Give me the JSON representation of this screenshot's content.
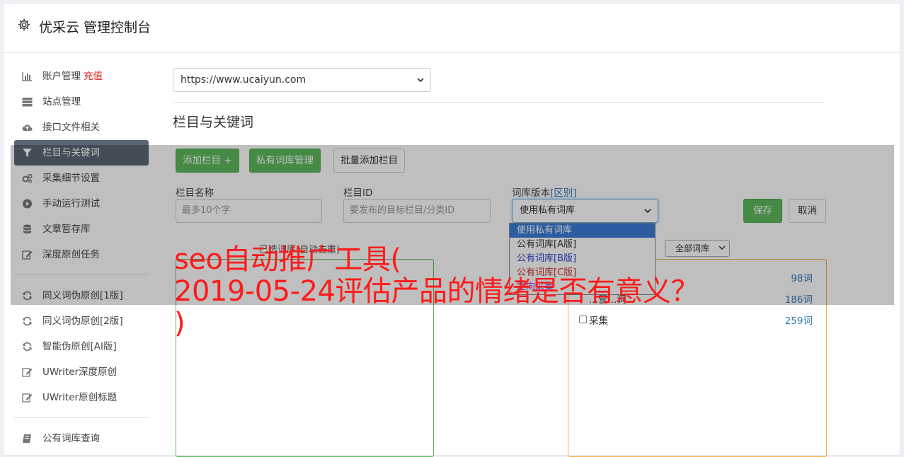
{
  "header": {
    "title": "优采云 管理控制台",
    "icon": "gear-icon"
  },
  "sidebar": {
    "items": [
      {
        "label": "账户管理",
        "badge": "充值",
        "icon": "bar-chart-icon"
      },
      {
        "label": "站点管理",
        "icon": "server-icon"
      },
      {
        "label": "接口文件相关",
        "icon": "cloud-upload-icon"
      },
      {
        "label": "栏目与关键词",
        "icon": "filter-icon",
        "active": true
      },
      {
        "label": "采集细节设置",
        "icon": "gears-icon"
      },
      {
        "label": "手动运行测试",
        "icon": "play-circle-icon"
      },
      {
        "label": "文章暂存库",
        "icon": "database-icon"
      },
      {
        "label": "深度原创任务",
        "icon": "edit-icon"
      }
    ],
    "items2": [
      {
        "label": "同义词伪原创[1版]",
        "icon": "refresh-icon"
      },
      {
        "label": "同义词伪原创[2版]",
        "icon": "refresh-icon"
      },
      {
        "label": "智能伪原创[AI版]",
        "icon": "refresh-icon"
      },
      {
        "label": "UWriter深度原创",
        "icon": "edit-icon"
      },
      {
        "label": "UWriter原创标题",
        "icon": "edit-icon"
      }
    ],
    "items3": [
      {
        "label": "公有词库查询",
        "icon": "book-icon"
      }
    ]
  },
  "main": {
    "site_select": "https://www.ucaiyun.com",
    "section_title": "栏目与关键词",
    "buttons": {
      "add_column": "添加栏目 +",
      "private_lib": "私有词库管理",
      "batch_add": "批量添加栏目",
      "save": "保存",
      "cancel": "取消"
    },
    "form": {
      "column_name_label": "栏目名称",
      "column_name_placeholder": "最多10个字",
      "column_id_label": "栏目ID",
      "column_id_placeholder": "要发布的目标栏目/分类ID",
      "lib_version_label": "词库版本",
      "lib_version_link": "[区别]",
      "lib_version_value": "使用私有词库"
    },
    "dropdown_options": [
      {
        "label": "使用私有词库",
        "color": "#ffffff",
        "selected": true
      },
      {
        "label": "公有词库[A版]",
        "color": "#333333"
      },
      {
        "label": "公有词库[B版]",
        "color": "#3344cc"
      },
      {
        "label": "公有词库[C版]",
        "color": "#cc3333"
      },
      {
        "label": "定向采集",
        "color": "#9933cc"
      }
    ],
    "selected_lib_title": "已选词库(自动去重)",
    "all_libs_select": "全部词库",
    "lib_rows": [
      {
        "name": "",
        "count": "98词"
      },
      {
        "name": "...营...词",
        "count": "186词"
      },
      {
        "name": "采集",
        "count": "259词"
      }
    ]
  },
  "overlay_headline": "seo自动推广工具(\n2019-05-24评估产品的情绪是否有意义？\n)"
}
